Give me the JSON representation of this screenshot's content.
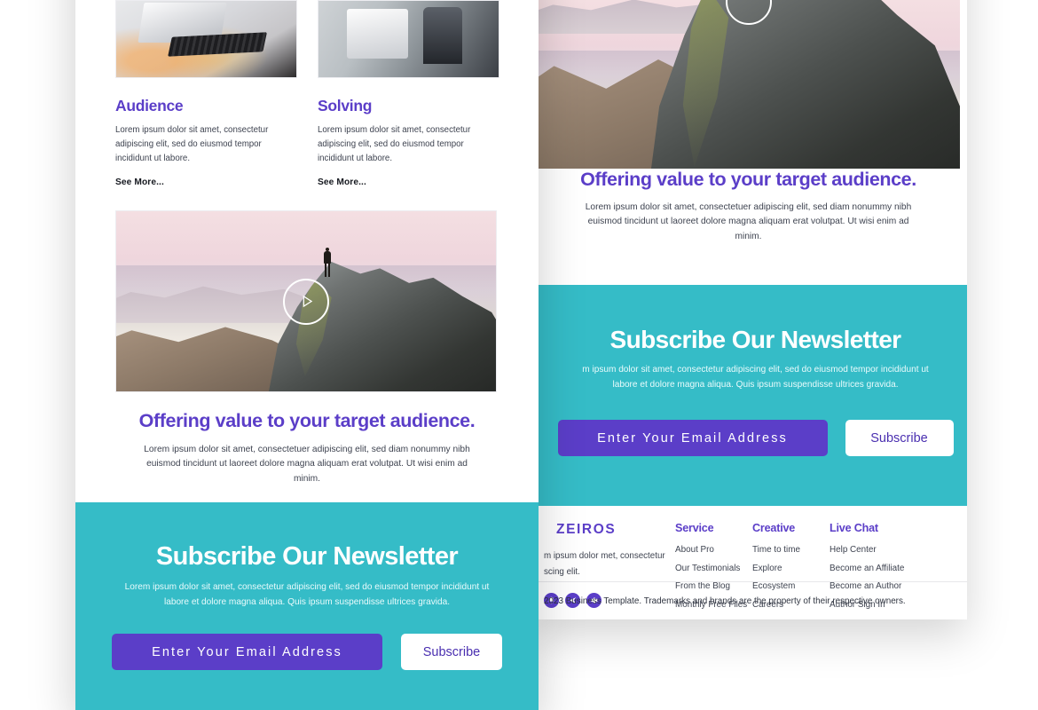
{
  "brand": {
    "accent_purple": "#5b3ec8",
    "accent_teal": "#35bcc7",
    "text_dark": "#3e4350"
  },
  "left_panel": {
    "cards": [
      {
        "title": "Audience",
        "body": "Lorem ipsum dolor sit amet, consectetur adipiscing elit, sed do eiusmod tempor incididunt ut labore.",
        "link": "See More..."
      },
      {
        "title": "Solving",
        "body": "Lorem ipsum dolor sit amet, consectetur adipiscing elit, sed do eiusmod tempor incididunt ut labore.",
        "link": "See More..."
      }
    ],
    "video": {
      "play_label": "Play video"
    },
    "offer": {
      "heading": "Offering value to your target audience.",
      "body": "Lorem ipsum dolor sit amet, consectetuer adipiscing elit, sed diam nonummy nibh euismod tincidunt ut laoreet dolore magna aliquam erat volutpat. Ut wisi enim ad minim."
    },
    "newsletter": {
      "heading": "Subscribe Our Newsletter",
      "body": "Lorem ipsum dolor sit amet, consectetur adipiscing elit, sed do eiusmod tempor incididunt ut labore et dolore magna aliqua. Quis ipsum suspendisse ultrices gravida.",
      "email_placeholder": "Enter Your Email Address",
      "email_value": "",
      "button_label": "Subscribe"
    }
  },
  "right_panel": {
    "offer": {
      "heading": "Offering value to your target audience.",
      "body": "Lorem ipsum dolor sit amet, consectetuer adipiscing elit, sed diam nonummy nibh euismod tincidunt ut laoreet dolore magna aliquam erat volutpat. Ut wisi enim ad minim."
    },
    "newsletter": {
      "heading": "Subscribe Our Newsletter",
      "body": "m ipsum dolor sit amet, consectetur adipiscing elit, sed do eiusmod tempor incididunt ut labore et dolore magna aliqua. Quis ipsum suspendisse ultrices gravida.",
      "email_placeholder": "Enter Your Email Address",
      "email_value": "",
      "button_label": "Subscribe"
    },
    "footer": {
      "logo": "ZEIROS",
      "blurb": "m ipsum dolor met, consectetur scing elit.",
      "social": [
        {
          "name": "bell-icon"
        },
        {
          "name": "send-icon"
        },
        {
          "name": "gear-icon"
        }
      ],
      "columns": [
        {
          "title": "Service",
          "links": [
            "About Pro",
            "Our Testimonials",
            "From the Blog",
            "Monthly Free Files"
          ]
        },
        {
          "title": "Creative",
          "links": [
            "Time to time",
            "Explore",
            "Ecosystem",
            "Careers"
          ]
        },
        {
          "title": "Live Chat",
          "links": [
            "Help Center",
            "Become an Affiliate",
            "Become an Author",
            "Author Sign In"
          ]
        }
      ],
      "copyright": "2023 Business Template. Trademarks and brands are the property of their respective owners."
    }
  }
}
